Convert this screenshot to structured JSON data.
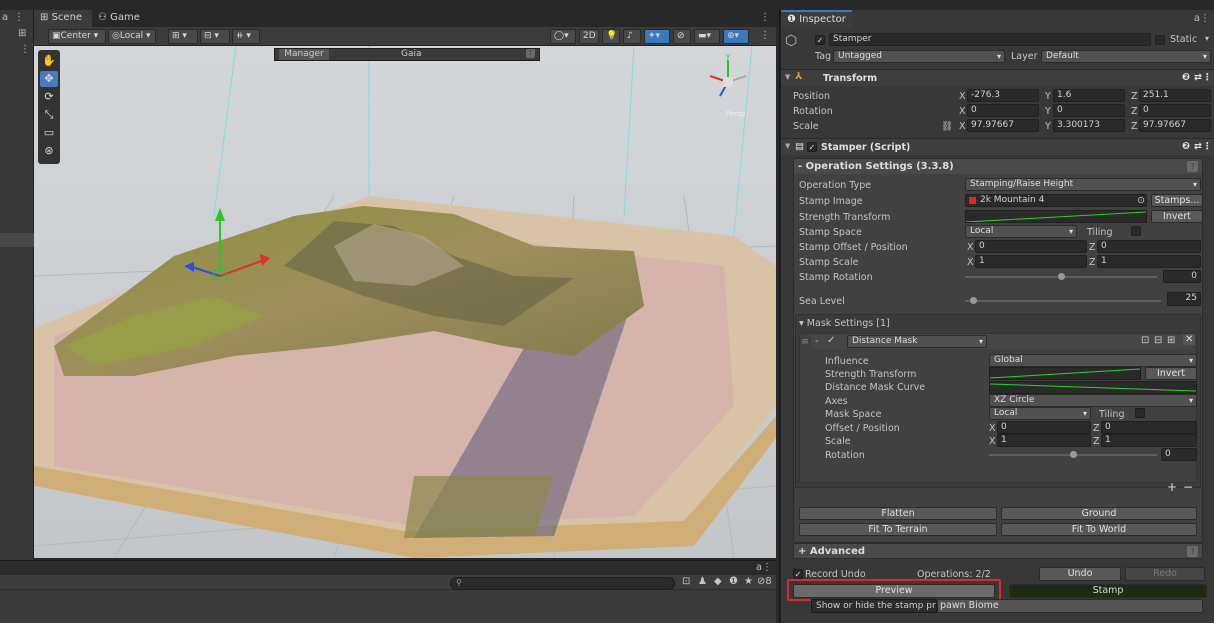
{
  "scene": {
    "tabs": [
      {
        "label": "Scene",
        "icon": "grid-icon"
      },
      {
        "label": "Game",
        "icon": "gamepad-icon"
      }
    ],
    "pivot_label": "Center",
    "space_label": "Local",
    "toggle_2d": "2D",
    "gaia_title": "Gaia",
    "gaia_manager": "Manager",
    "persp_label": "Persp",
    "search_placeholder": "",
    "console_count": "8"
  },
  "inspector": {
    "tab": "Inspector",
    "object_name": "Stamper",
    "static_label": "Static",
    "tag_label": "Tag",
    "tag_value": "Untagged",
    "layer_label": "Layer",
    "layer_value": "Default",
    "transform": {
      "title": "Transform",
      "rows": [
        {
          "label": "Position",
          "x": "-276.3",
          "y": "1.6",
          "z": "251.1"
        },
        {
          "label": "Rotation",
          "x": "0",
          "y": "0",
          "z": "0"
        },
        {
          "label": "Scale",
          "x": "97.97667",
          "y": "3.300173",
          "z": "97.97667"
        }
      ]
    },
    "script": {
      "title": "Stamper (Script)",
      "op_settings": "- Operation Settings  (3.3.8)",
      "rows": {
        "operation_type": {
          "label": "Operation Type",
          "value": "Stamping/Raise Height"
        },
        "stamp_image": {
          "label": "Stamp Image",
          "value": "2k Mountain 4",
          "button": "Stamps..."
        },
        "strength_transform": {
          "label": "Strength Transform",
          "button": "Invert"
        },
        "stamp_space": {
          "label": "Stamp Space",
          "value": "Local",
          "tiling": "Tiling"
        },
        "stamp_offset": {
          "label": "Stamp Offset / Position",
          "x": "0",
          "z": "0"
        },
        "stamp_scale": {
          "label": "Stamp Scale",
          "x": "1",
          "z": "1"
        },
        "stamp_rotation": {
          "label": "Stamp Rotation",
          "value": "0",
          "fraction": 0.5
        },
        "sea_level": {
          "label": "Sea Level",
          "value": "25",
          "fraction": 0.04
        }
      },
      "mask_settings": "Mask Settings [1]",
      "mask": {
        "name": "Distance Mask",
        "influence": {
          "label": "Influence",
          "value": "Global"
        },
        "strength_transform": {
          "label": "Strength Transform",
          "button": "Invert"
        },
        "curve_label": "Distance Mask Curve",
        "axes": {
          "label": "Axes",
          "value": "XZ Circle"
        },
        "mask_space": {
          "label": "Mask Space",
          "value": "Local",
          "tiling": "Tiling"
        },
        "offset": {
          "label": "Offset / Position",
          "x": "0",
          "z": "0"
        },
        "scale": {
          "label": "Scale",
          "x": "1",
          "z": "1"
        },
        "rotation": {
          "label": "Rotation",
          "value": "0",
          "fraction": 0.5
        }
      },
      "buttons": {
        "flatten": "Flatten",
        "ground": "Ground",
        "fit_terrain": "Fit To Terrain",
        "fit_world": "Fit To World"
      },
      "advanced": "+ Advanced",
      "record_undo": "Record Undo",
      "operations": "Operations: 2/2",
      "undo": "Undo",
      "redo": "Redo",
      "preview": "Preview",
      "stamp": "Stamp",
      "tooltip": "Show or hide the stamp preview mesh.",
      "spawn_biome_tail": "pawn Biome"
    }
  },
  "colors": {
    "accent": "#3a79bb",
    "highlight": "#e0262a",
    "stamp_button": "#1f2b10",
    "curve_green": "#27d327"
  }
}
